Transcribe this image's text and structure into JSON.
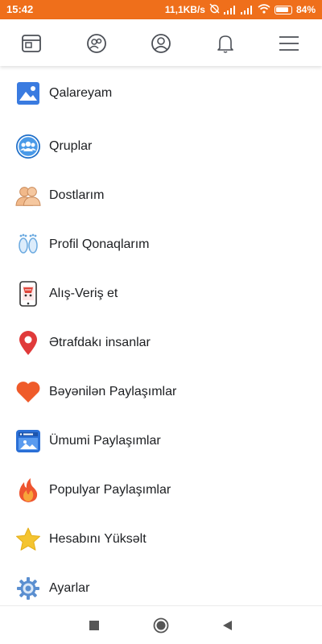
{
  "status_bar": {
    "time": "15:42",
    "speed": "11,1KB/s",
    "battery": "84%",
    "color": "#ef6f1b"
  },
  "top_nav": {
    "icons": [
      "feed-icon",
      "groups-icon",
      "profile-icon",
      "bell-icon",
      "hamburger-menu-icon"
    ]
  },
  "menu": {
    "items": [
      {
        "label": "Qalareyam",
        "icon": "gallery-icon"
      },
      {
        "label": "Qruplar",
        "icon": "groups-icon"
      },
      {
        "label": "Dostlarım",
        "icon": "friends-icon"
      },
      {
        "label": "Profil Qonaqlarım",
        "icon": "footprints-icon"
      },
      {
        "label": "Alış-Veriş et",
        "icon": "shopping-icon"
      },
      {
        "label": "Ətrafdakı insanlar",
        "icon": "location-pin-icon"
      },
      {
        "label": "Bəyənilən Paylaşımlar",
        "icon": "heart-icon"
      },
      {
        "label": "Ümumi Paylaşımlar",
        "icon": "public-posts-icon"
      },
      {
        "label": "Populyar Paylaşımlar",
        "icon": "fire-icon"
      },
      {
        "label": "Hesabını Yüksəlt",
        "icon": "star-icon"
      },
      {
        "label": "Ayarlar",
        "icon": "gear-icon"
      }
    ]
  },
  "system_nav": {
    "buttons": [
      "recents-square-icon",
      "home-circle-icon",
      "back-triangle-icon"
    ]
  }
}
